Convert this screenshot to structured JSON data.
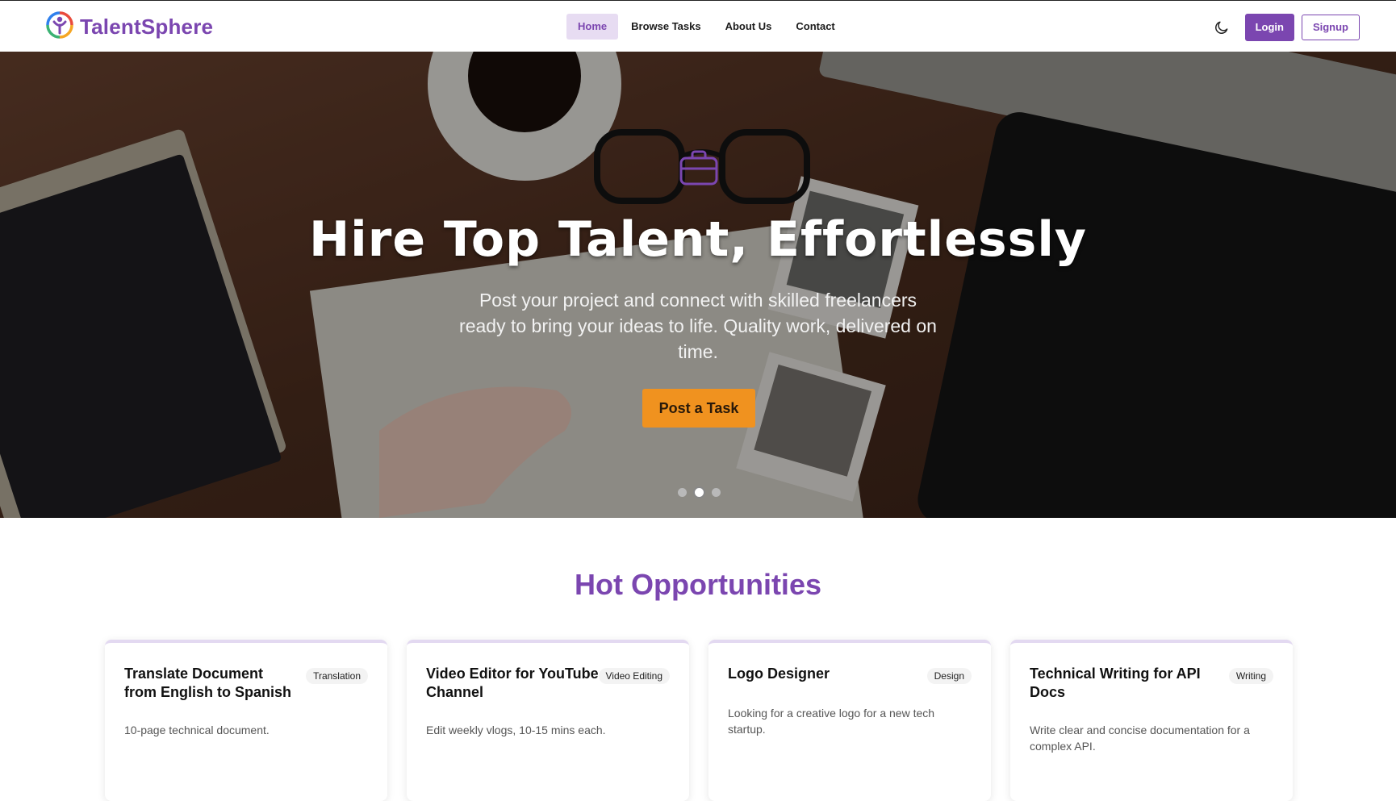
{
  "brand": {
    "name": "TalentSphere"
  },
  "nav": {
    "links": [
      {
        "label": "Home",
        "active": true
      },
      {
        "label": "Browse Tasks",
        "active": false
      },
      {
        "label": "About Us",
        "active": false
      },
      {
        "label": "Contact",
        "active": false
      }
    ],
    "login_label": "Login",
    "signup_label": "Signup",
    "theme_icon": "moon-icon"
  },
  "hero": {
    "icon": "briefcase-icon",
    "title": "Hire Top Talent, Effortlessly",
    "subtitle": "Post your project and connect with skilled freelancers ready to bring your ideas to life. Quality work, delivered on time.",
    "cta_label": "Post a Task",
    "slides_count": 3,
    "active_slide": 2
  },
  "opportunities": {
    "title": "Hot Opportunities",
    "cards": [
      {
        "title": "Translate Document from English to Spanish",
        "tag": "Translation",
        "description": "10-page technical document."
      },
      {
        "title": "Video Editor for YouTube Channel",
        "tag": "Video Editing",
        "description": "Edit weekly vlogs, 10-15 mins each."
      },
      {
        "title": "Logo Designer",
        "tag": "Design",
        "description": "Looking for a creative logo for a new tech startup."
      },
      {
        "title": "Technical Writing for API Docs",
        "tag": "Writing",
        "description": "Write clear and concise documentation for a complex API."
      }
    ]
  },
  "colors": {
    "brand": "#7b46b0",
    "accent": "#f0921f",
    "active_nav_bg": "#e7dcf2"
  }
}
